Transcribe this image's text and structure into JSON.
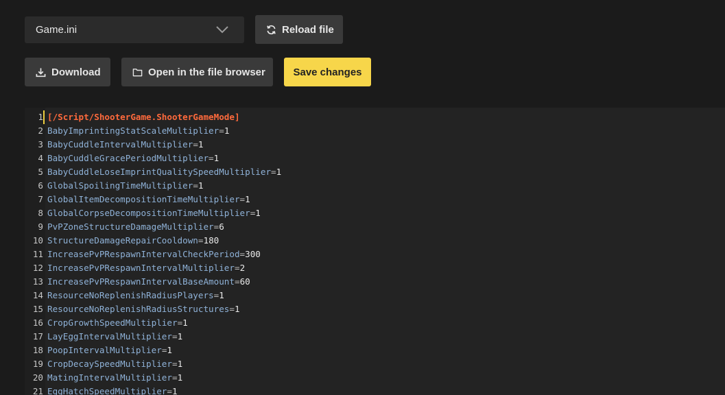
{
  "file_select": {
    "value": "Game.ini"
  },
  "buttons": {
    "reload": "Reload file",
    "download": "Download",
    "open_browser": "Open in the file browser",
    "save": "Save changes"
  },
  "colors": {
    "accent": "#f7d64a",
    "section": "#ff6a3c",
    "key": "#8fb2d8"
  },
  "editor": {
    "lines": [
      {
        "num": "1",
        "section": "[/Script/ShooterGame.ShooterGameMode]"
      },
      {
        "num": "2",
        "key": "BabyImprintingStatScaleMultiplier",
        "value": "1"
      },
      {
        "num": "3",
        "key": "BabyCuddleIntervalMultiplier",
        "value": "1"
      },
      {
        "num": "4",
        "key": "BabyCuddleGracePeriodMultiplier",
        "value": "1"
      },
      {
        "num": "5",
        "key": "BabyCuddleLoseImprintQualitySpeedMultiplier",
        "value": "1"
      },
      {
        "num": "6",
        "key": "GlobalSpoilingTimeMultiplier",
        "value": "1"
      },
      {
        "num": "7",
        "key": "GlobalItemDecompositionTimeMultiplier",
        "value": "1"
      },
      {
        "num": "8",
        "key": "GlobalCorpseDecompositionTimeMultiplier",
        "value": "1"
      },
      {
        "num": "9",
        "key": "PvPZoneStructureDamageMultiplier",
        "value": "6"
      },
      {
        "num": "10",
        "key": "StructureDamageRepairCooldown",
        "value": "180"
      },
      {
        "num": "11",
        "key": "IncreasePvPRespawnIntervalCheckPeriod",
        "value": "300"
      },
      {
        "num": "12",
        "key": "IncreasePvPRespawnIntervalMultiplier",
        "value": "2"
      },
      {
        "num": "13",
        "key": "IncreasePvPRespawnIntervalBaseAmount",
        "value": "60"
      },
      {
        "num": "14",
        "key": "ResourceNoReplenishRadiusPlayers",
        "value": "1"
      },
      {
        "num": "15",
        "key": "ResourceNoReplenishRadiusStructures",
        "value": "1"
      },
      {
        "num": "16",
        "key": "CropGrowthSpeedMultiplier",
        "value": "1"
      },
      {
        "num": "17",
        "key": "LayEggIntervalMultiplier",
        "value": "1"
      },
      {
        "num": "18",
        "key": "PoopIntervalMultiplier",
        "value": "1"
      },
      {
        "num": "19",
        "key": "CropDecaySpeedMultiplier",
        "value": "1"
      },
      {
        "num": "20",
        "key": "MatingIntervalMultiplier",
        "value": "1"
      },
      {
        "num": "21",
        "key": "EggHatchSpeedMultiplier",
        "value": "1"
      }
    ]
  }
}
